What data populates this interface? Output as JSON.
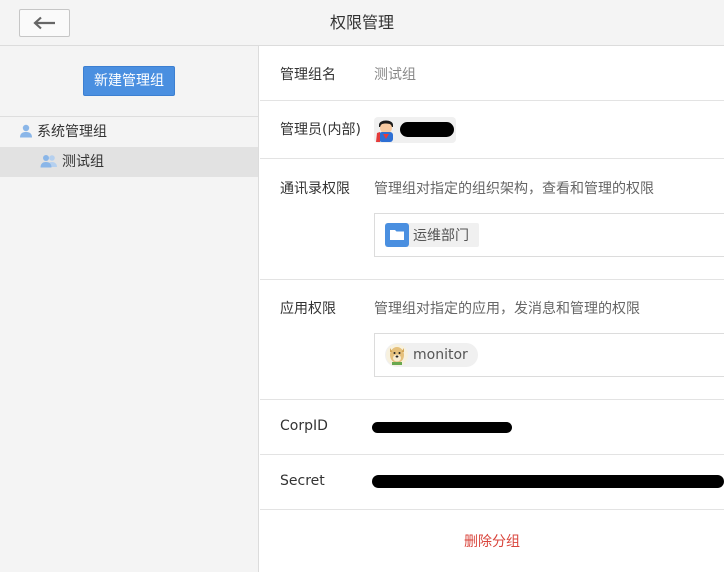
{
  "header": {
    "title": "权限管理",
    "back_icon": "arrow-left-icon"
  },
  "sidebar": {
    "new_group_label": "新建管理组",
    "tree": [
      {
        "label": "系统管理组",
        "icon": "user-icon",
        "selected": false
      },
      {
        "label": "测试组",
        "icon": "users-icon",
        "selected": true
      }
    ]
  },
  "form": {
    "group_name": {
      "label": "管理组名",
      "value": "测试组"
    },
    "admins": {
      "label": "管理员(内部)",
      "avatar_icon": "superman-avatar-icon"
    },
    "contacts": {
      "label": "通讯录权限",
      "desc": "管理组对指定的组织架构，查看和管理的权限",
      "items": [
        {
          "label": "运维部门",
          "icon": "folder-icon"
        }
      ]
    },
    "apps": {
      "label": "应用权限",
      "desc": "管理组对指定的应用，发消息和管理的权限",
      "items": [
        {
          "label": "monitor",
          "icon": "doge-app-icon"
        }
      ]
    },
    "corpid": {
      "label": "CorpID"
    },
    "secret": {
      "label": "Secret"
    },
    "delete_label": "删除分组"
  },
  "colors": {
    "primary": "#4a8fe0",
    "danger": "#d9453c",
    "folder": "#4a8fe0",
    "sidebar_bg": "#f4f4f4"
  }
}
